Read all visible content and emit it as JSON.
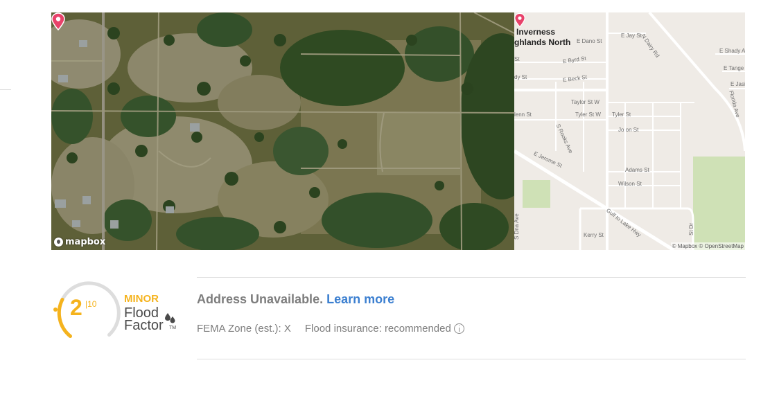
{
  "satellite_map": {
    "logo_text": "mapbox"
  },
  "street_map": {
    "labels": {
      "place_line1": "Inverness",
      "place_line2": "ghlands North",
      "e_dano_st": "E Dano St",
      "e_jay_st": "E Jay St",
      "n_dairy_rd": "N Dairy Rd",
      "e_shady": "E Shady A",
      "e_tange": "E Tange",
      "e_jasi": "E Jasi",
      "st_left": "St",
      "e_byrd_st": "E Byrd St",
      "dy_st": "dy St",
      "e_beck_st": "E Beck St",
      "florida_ave": "Florida Ave",
      "taylor_st_w": "Taylor St W",
      "lenn_st": "lenn St",
      "taylor_st_w2": "Tyler St W",
      "tyler_st": "Tyler St",
      "s_rooks_ave": "S Rooks Ave",
      "jackson_st": "Jo    on St",
      "e_jerome_st": "E Jerome St",
      "adams_st": "Adams St",
      "wilson_st": "Wilson St",
      "gulf_to_lake": "Gulf to Lake Hwy",
      "s_ave": "S Dna Ave",
      "kerry_st": "Kerry St",
      "st_dr": "St Dr"
    },
    "attribution": "© Mapbox © OpenStreetMap"
  },
  "flood_factor": {
    "score": "2",
    "score_of": "|10",
    "score_value": 2,
    "score_max": 10,
    "risk_level": "MINOR",
    "brand_line1": "Flood",
    "brand_line2": "Factor",
    "trademark": "TM",
    "colors": {
      "accent": "#f5b31d",
      "gauge_track": "#dddddd",
      "brand_text": "#4a4a4a"
    }
  },
  "info": {
    "address_text": "Address Unavailable.",
    "learn_more": "Learn more",
    "fema_zone": "FEMA Zone (est.): X",
    "flood_insurance": "Flood insurance: recommended",
    "colors": {
      "link": "#3b7fd0",
      "text": "#7d7d7d"
    }
  }
}
